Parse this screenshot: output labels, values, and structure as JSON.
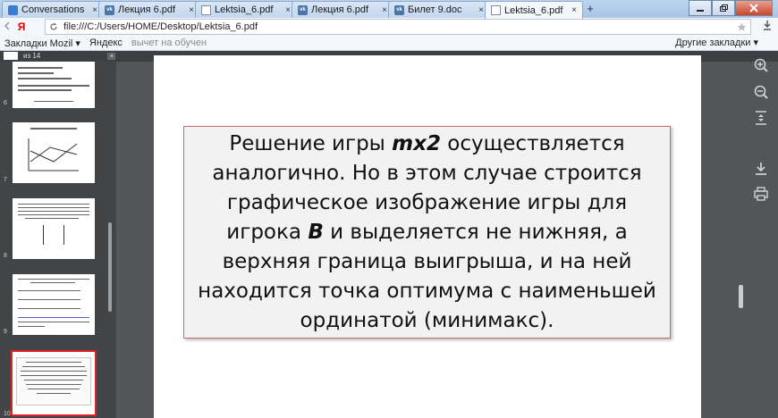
{
  "tabs": [
    {
      "label": "Conversations",
      "icon": "chat-icon"
    },
    {
      "label": "Лекция 6.pdf",
      "icon": "vk-icon"
    },
    {
      "label": "Lektsia_6.pdf",
      "icon": "document-icon"
    },
    {
      "label": "Лекция 6.pdf",
      "icon": "vk-icon"
    },
    {
      "label": "Билет 9.doc",
      "icon": "vk-icon"
    },
    {
      "label": "Lektsia_6.pdf",
      "icon": "document-icon",
      "active": true
    }
  ],
  "tab_close": "×",
  "vk_text": "vk",
  "new_tab": "+",
  "address": {
    "yandex_logo": "Я",
    "url": "file:///C:/Users/HOME/Desktop/Lektsia_6.pdf"
  },
  "bookmarks": {
    "items": [
      "Закладки Mozil",
      "Яндекс",
      "вычет на обучен"
    ],
    "other": "Другие закладки"
  },
  "viewer": {
    "page_of": "из 14",
    "thumb_numbers": [
      "6",
      "7",
      "8",
      "9",
      "10"
    ],
    "slide_parts": [
      "Решение игры ",
      "mx2",
      " осуществляется аналогично. Но в этом случае строится графическое изображение игры для игрока ",
      "B",
      " и выделяется не нижняя, а верхняя граница выигрыша, и на ней находится точка оптимума с наименьшей ординатой (минимакс)."
    ]
  },
  "colors": {
    "viewer_bg": "#525659",
    "sidebar_bg": "#414548",
    "selected_thumb": "#e02020",
    "slide_border": "#c46a6a"
  }
}
